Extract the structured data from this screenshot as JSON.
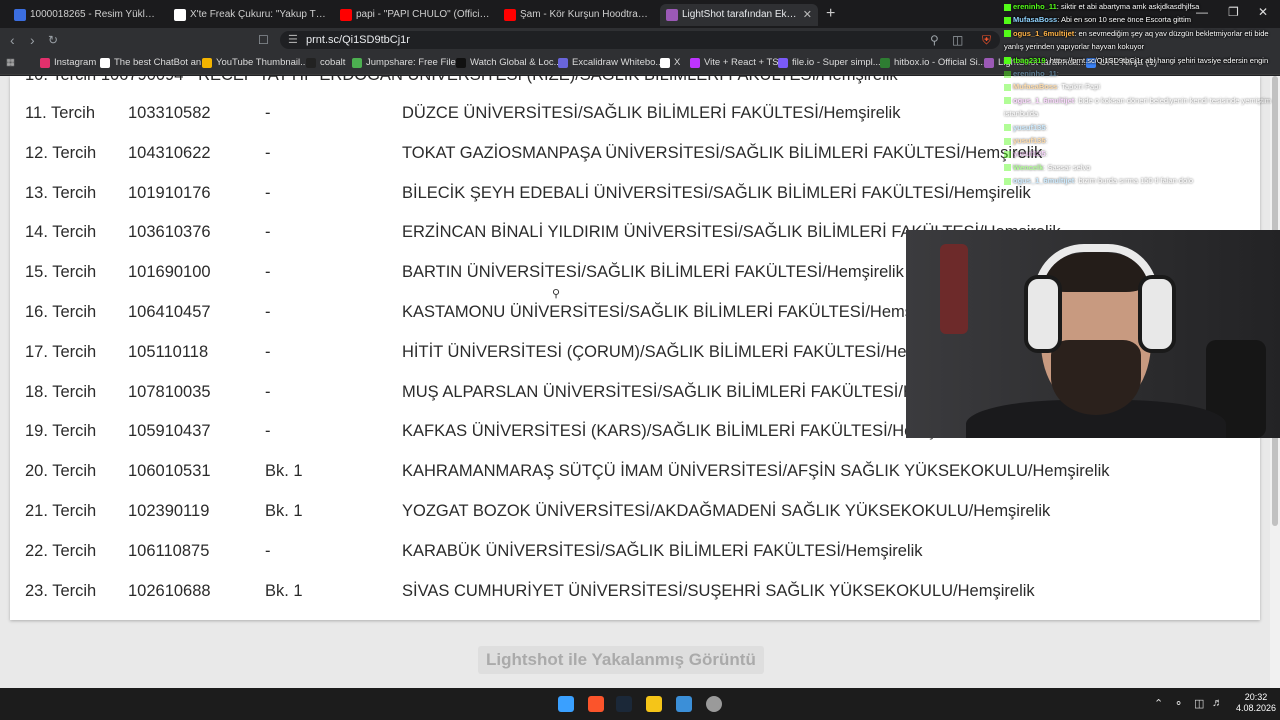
{
  "browser": {
    "tabs": [
      {
        "label": "1000018265 - Resim Yükle - Hızlı Resi...",
        "color": "#3b6ee0"
      },
      {
        "label": "X'te Freak Çukuru: \"Yakup TV, kızlarda...",
        "color": "#ffffff"
      },
      {
        "label": "papi - \"PAPI CHULO\" (Official Music V...",
        "color": "#ff0000"
      },
      {
        "label": "Şam - Kör Kurşun Hoodtrap | @Efesos...",
        "color": "#ff0000"
      },
      {
        "label": "LightShot tarafından Ekran Görün...",
        "color": "#9b59b6"
      }
    ],
    "new_tab": "+",
    "close": "✕",
    "url": "prnt.sc/Qi1SD9tbCj1r",
    "bookmarks": [
      {
        "label": "Instagram",
        "color": "#e1306c"
      },
      {
        "label": "The best ChatBot an...",
        "color": "#ffffff"
      },
      {
        "label": "YouTube Thumbnail...",
        "color": "#f4b400"
      },
      {
        "label": "cobalt",
        "color": "#222222"
      },
      {
        "label": "Jumpshare: Free File...",
        "color": "#4caf50"
      },
      {
        "label": "Watch Global & Loc...",
        "color": "#111111"
      },
      {
        "label": "Excalidraw Whitebo...",
        "color": "#6965db"
      },
      {
        "label": "X",
        "color": "#ffffff"
      },
      {
        "label": "Vite + React + TS",
        "color": "#bd34fe"
      },
      {
        "label": "file.io - Super simpl...",
        "color": "#7a5af8"
      },
      {
        "label": "hitbox.io - Official Si...",
        "color": "#2e7d32"
      },
      {
        "label": "LightShot tarafında...",
        "color": "#9b59b6"
      },
      {
        "label": "URL Ninja (1)",
        "color": "#3b82f6"
      }
    ]
  },
  "table": {
    "partial_top": "10. Tercih 106790094 - RECEP TAYYİP ERDOĞAN ÜNİVERSİTESİ (RİZE)/SAĞLIK BİLİMLERİ FAKÜLTESİ/Hemşirelik",
    "rows": [
      {
        "rank": "11. Tercih",
        "code": "103310582",
        "note": "-",
        "program": "DÜZCE ÜNİVERSİTESİ/SAĞLIK BİLİMLERİ FAKÜLTESİ/Hemşirelik"
      },
      {
        "rank": "12. Tercih",
        "code": "104310622",
        "note": "-",
        "program": "TOKAT GAZİOSMANPAŞA ÜNİVERSİTESİ/SAĞLIK BİLİMLERİ FAKÜLTESİ/Hemşirelik"
      },
      {
        "rank": "13. Tercih",
        "code": "101910176",
        "note": "-",
        "program": "BİLECİK ŞEYH EDEBALİ ÜNİVERSİTESİ/SAĞLIK BİLİMLERİ FAKÜLTESİ/Hemşirelik"
      },
      {
        "rank": "14. Tercih",
        "code": "103610376",
        "note": "-",
        "program": "ERZİNCAN BİNALİ YILDIRIM ÜNİVERSİTESİ/SAĞLIK BİLİMLERİ FAKÜLTESİ/Hemşirelik"
      },
      {
        "rank": "15. Tercih",
        "code": "101690100",
        "note": "-",
        "program": "BARTIN ÜNİVERSİTESİ/SAĞLIK BİLİMLERİ FAKÜLTESİ/Hemşirelik"
      },
      {
        "rank": "16. Tercih",
        "code": "106410457",
        "note": "-",
        "program": "KASTAMONU ÜNİVERSİTESİ/SAĞLIK BİLİMLERİ FAKÜLTESİ/Hemşirelik"
      },
      {
        "rank": "17. Tercih",
        "code": "105110118",
        "note": "-",
        "program": "HİTİT ÜNİVERSİTESİ (ÇORUM)/SAĞLIK BİLİMLERİ FAKÜLTESİ/Hemşirelik"
      },
      {
        "rank": "18. Tercih",
        "code": "107810035",
        "note": "-",
        "program": "MUŞ ALPARSLAN ÜNİVERSİTESİ/SAĞLIK BİLİMLERİ FAKÜLTESİ/Hemşirelik"
      },
      {
        "rank": "19. Tercih",
        "code": "105910437",
        "note": "-",
        "program": "KAFKAS ÜNİVERSİTESİ (KARS)/SAĞLIK BİLİMLERİ FAKÜLTESİ/Hemşirelik"
      },
      {
        "rank": "20. Tercih",
        "code": "106010531",
        "note": "Bk. 1",
        "program": "KAHRAMANMARAŞ SÜTÇÜ İMAM ÜNİVERSİTESİ/AFŞİN SAĞLIK YÜKSEKOKULU/Hemşirelik"
      },
      {
        "rank": "21. Tercih",
        "code": "102390119",
        "note": "Bk. 1",
        "program": "YOZGAT BOZOK ÜNİVERSİTESİ/AKDAĞMADENİ SAĞLIK YÜKSEKOKULU/Hemşirelik"
      },
      {
        "rank": "22. Tercih",
        "code": "106110875",
        "note": "-",
        "program": "KARABÜK ÜNİVERSİTESİ/SAĞLIK BİLİMLERİ FAKÜLTESİ/Hemşirelik"
      },
      {
        "rank": "23. Tercih",
        "code": "102610688",
        "note": "Bk. 1",
        "program": "SİVAS CUMHURİYET ÜNİVERSİTESİ/SUŞEHRİ SAĞLIK YÜKSEKOKULU/Hemşirelik"
      }
    ]
  },
  "footer_title": "Lightshot ile Yakalanmış Görüntü",
  "chat": [
    {
      "user": "ereninho_11",
      "text": ": siktir et abi abartyma amk askjdkasdhjlfsa",
      "faint": false
    },
    {
      "user": "MufasaBoss",
      "text": ": Abi en son 10 sene önce Escorta gittim",
      "faint": false
    },
    {
      "user": "ogus_1_6multijet",
      "text": ": en sevmediğim şey aq yav düzgün bekletmiyorlar eti bide",
      "faint": false
    },
    {
      "user": "",
      "text": "yanlış yerinden yapıyorlar hayvan kokuyor",
      "faint": false
    },
    {
      "user": "tbag2319",
      "text": ": https://prnt.sc/Qi1SD9tbCj1r abi hangi şehiri tavsiye edersin engin",
      "faint": false
    },
    {
      "user": "ereninho_11",
      "text": ": ",
      "faint": true
    },
    {
      "user": "MufasaBoss",
      "text": ": Tapkiri Papi",
      "faint": true
    },
    {
      "user": "ogus_1_6multijet",
      "text": ": bide o koksan döneri belediyenin kendi tesisinde yemiştim",
      "faint": true
    },
    {
      "user": "",
      "text": "istanbulda",
      "faint": true
    },
    {
      "user": "yusuf135",
      "text": ": ",
      "faint": true
    },
    {
      "user": "yusuf135",
      "text": ": ",
      "faint": true
    },
    {
      "user": "yusuf135",
      "text": ": ",
      "faint": true
    },
    {
      "user": "Wencelk",
      "text": ": Sassar selvo",
      "faint": true
    },
    {
      "user": "ogus_1_6multijet",
      "text": ": bizim burda sırma 150 tl falan dolo",
      "faint": true
    }
  ],
  "taskbar": {
    "icons": [
      {
        "name": "start",
        "color": "#3aa0ff"
      },
      {
        "name": "brave",
        "color": "#fb542b"
      },
      {
        "name": "steam",
        "color": "#1b2838"
      },
      {
        "name": "files",
        "color": "#f5c518"
      },
      {
        "name": "store",
        "color": "#3b8fd8"
      },
      {
        "name": "obs",
        "color": "#9a9a9a"
      }
    ],
    "time": "20:32",
    "date": "4.08.2026"
  }
}
